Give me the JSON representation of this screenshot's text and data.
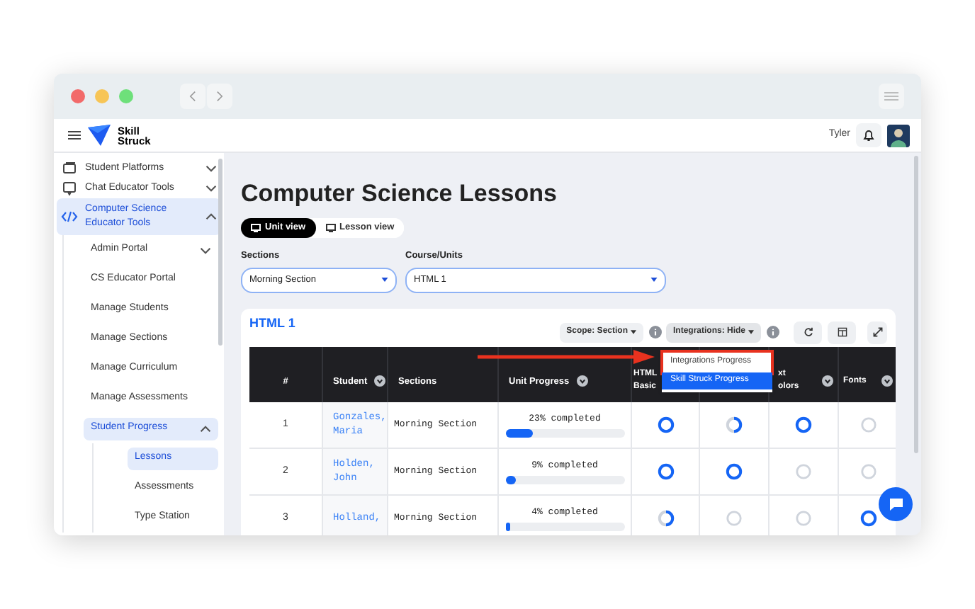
{
  "app": {
    "logo_text": [
      "Skill",
      "Struck"
    ],
    "user_name": "Tyler"
  },
  "sidebar": {
    "items": [
      {
        "label": "Student Platforms",
        "expanded": false,
        "selected": false
      },
      {
        "label": "Chat Educator Tools",
        "expanded": false,
        "selected": false
      },
      {
        "label": "Computer Science Educator Tools",
        "expanded": true,
        "selected": true,
        "children": [
          {
            "label": "Admin Portal",
            "expanded": false,
            "selected": false
          },
          {
            "label": "CS Educator Portal",
            "selected": false
          },
          {
            "label": "Manage Students",
            "selected": false
          },
          {
            "label": "Manage Sections",
            "selected": false
          },
          {
            "label": "Manage Curriculum",
            "selected": false
          },
          {
            "label": "Manage Assessments",
            "selected": false
          },
          {
            "label": "Student Progress",
            "expanded": true,
            "selected": true,
            "children": [
              {
                "label": "Lessons",
                "selected": true
              },
              {
                "label": "Assessments",
                "selected": false
              },
              {
                "label": "Type Station",
                "selected": false
              }
            ]
          }
        ]
      }
    ]
  },
  "page": {
    "title": "Computer Science Lessons",
    "view_tabs": [
      {
        "label": "Unit view",
        "selected": true
      },
      {
        "label": "Lesson view",
        "selected": false
      }
    ],
    "filters": [
      {
        "label": "Sections",
        "value": "Morning Section"
      },
      {
        "label": "Course/Units",
        "value": "HTML 1"
      }
    ]
  },
  "card": {
    "title": "HTML 1",
    "scope_button": "Scope: Section",
    "integrations_button": "Integrations: Hide",
    "integrations_menu": [
      {
        "label": "Integrations Progress",
        "selected": false,
        "highlighted": true
      },
      {
        "label": "Skill Struck Progress",
        "selected": true,
        "highlighted": false
      }
    ],
    "table": {
      "columns": [
        {
          "label": "#",
          "sortable": false
        },
        {
          "label": "Student",
          "sortable": true
        },
        {
          "label": "Sections",
          "sortable": false
        },
        {
          "label": "Unit Progress",
          "sortable": true
        },
        {
          "label": "HTML Basic"
        },
        {},
        {
          "label": "xt olors",
          "sortable": true
        },
        {
          "label": "Fonts",
          "sortable": true
        }
      ],
      "rows": [
        {
          "number": "1",
          "student": "Gonzales, Maria",
          "section": "Morning Section",
          "progress": "23% completed",
          "level": 0.23,
          "lessons": [
            {
              "kind": "complete"
            },
            {
              "kind": "partial"
            },
            {
              "kind": "complete"
            },
            {
              "kind": "empty"
            }
          ]
        },
        {
          "number": "2",
          "student": "Holden, John",
          "section": "Morning Section",
          "progress": "9% completed",
          "level": 0.09,
          "lessons": [
            {
              "kind": "complete"
            },
            {
              "kind": "complete"
            },
            {
              "kind": "empty"
            },
            {
              "kind": "empty"
            }
          ]
        },
        {
          "number": "3",
          "student": "Holland,",
          "section": "Morning Section",
          "progress": "4% completed",
          "level": 0.04,
          "lessons": [
            {
              "kind": "partial"
            },
            {
              "kind": "empty"
            },
            {
              "kind": "empty"
            },
            {
              "kind": "complete"
            }
          ]
        }
      ]
    }
  }
}
